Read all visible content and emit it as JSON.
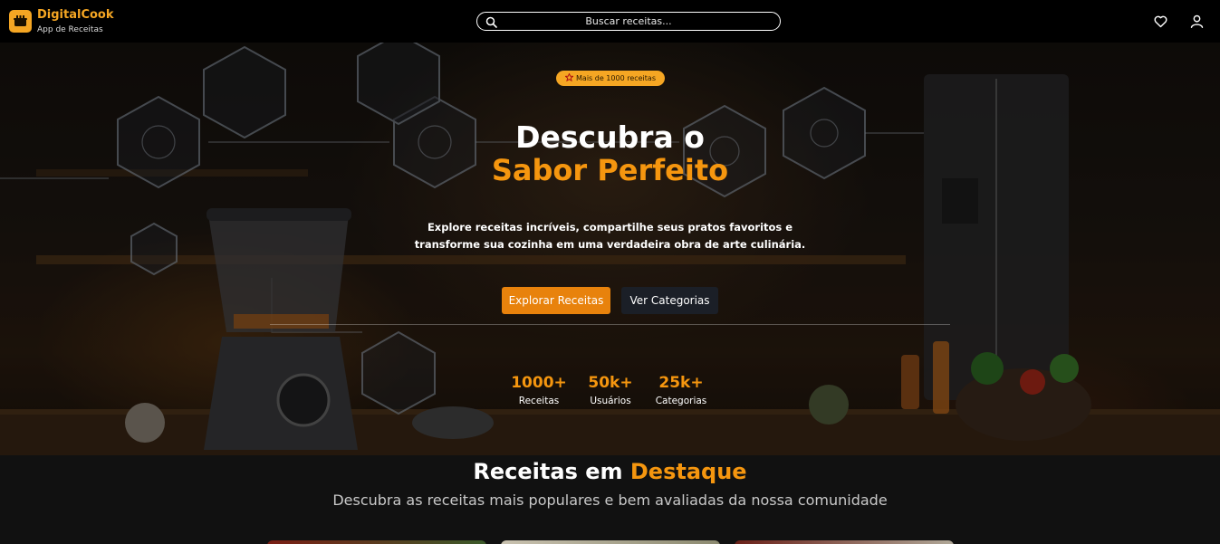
{
  "app": {
    "name": "DigitalCook",
    "subtitle": "App de Receitas"
  },
  "search": {
    "placeholder": "Buscar receitas..."
  },
  "hero": {
    "badge": "Mais de 1000 receitas",
    "title_line1": "Descubra o",
    "title_line2": "Sabor Perfeito",
    "description": "Explore receitas incríveis, compartilhe seus pratos favoritos e transforme sua cozinha em uma verdadeira obra de arte culinária.",
    "primary_button": "Explorar Receitas",
    "secondary_button": "Ver Categorias",
    "stats": [
      {
        "value": "1000+",
        "label": "Receitas"
      },
      {
        "value": "50k+",
        "label": "Usuários"
      },
      {
        "value": "25k+",
        "label": "Categorias"
      }
    ]
  },
  "featured": {
    "title_white": "Receitas em",
    "title_orange": "Destaque",
    "subtitle": "Descubra as receitas mais populares e bem avaliadas da nossa comunidade"
  },
  "colors": {
    "accent": "#f5960f",
    "badge": "#f5a623",
    "primary_button": "#e8820c",
    "secondary_button": "#1b1f27",
    "topbar": "#000000"
  },
  "icons": {
    "logo": "cooking-pot-icon",
    "search": "search-icon",
    "favorites": "heart-icon",
    "account": "user-icon",
    "badge": "star-icon"
  }
}
